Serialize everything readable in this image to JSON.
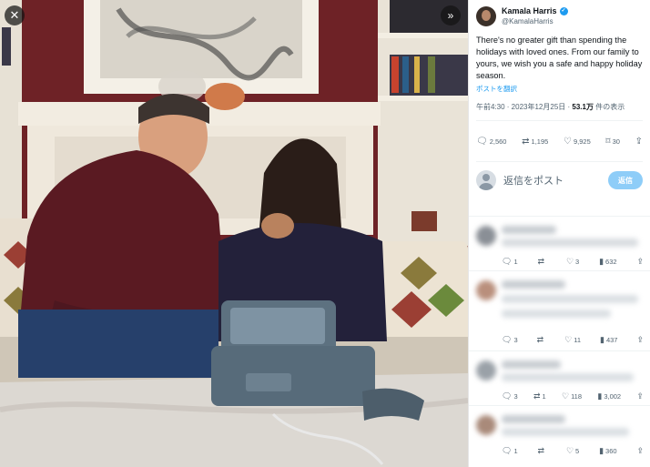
{
  "photo": {
    "close_icon": "close-icon",
    "expand_icon": "expand-icon"
  },
  "tweet": {
    "author_name": "Kamala Harris",
    "author_handle": "@KamalaHarris",
    "text": "There's no greater gift than spending the holidays with loved ones. From our family to yours, we wish you a safe and happy holiday season.",
    "translate_label": "ポストを翻訳",
    "timestamp": "午前4:30 · 2023年12月25日 · ",
    "views_count": "53.1万",
    "views_label": " 件の表示",
    "metrics": {
      "replies": "2,560",
      "reposts": "1,195",
      "likes": "9,925",
      "bookmarks": "30"
    }
  },
  "reply_composer": {
    "placeholder": "返信をポスト",
    "button_label": "返信"
  },
  "replies": [
    {
      "replies": "1",
      "reposts": "",
      "likes": "3",
      "views": "632"
    },
    {
      "replies": "3",
      "reposts": "",
      "likes": "11",
      "views": "437"
    },
    {
      "replies": "3",
      "reposts": "1",
      "likes": "118",
      "views": "3,002"
    },
    {
      "replies": "1",
      "reposts": "",
      "likes": "5",
      "views": "360"
    }
  ],
  "colors": {
    "accent": "#1d9bf0",
    "reply_button": "#8ecdf8",
    "wall": "#6b2024"
  }
}
